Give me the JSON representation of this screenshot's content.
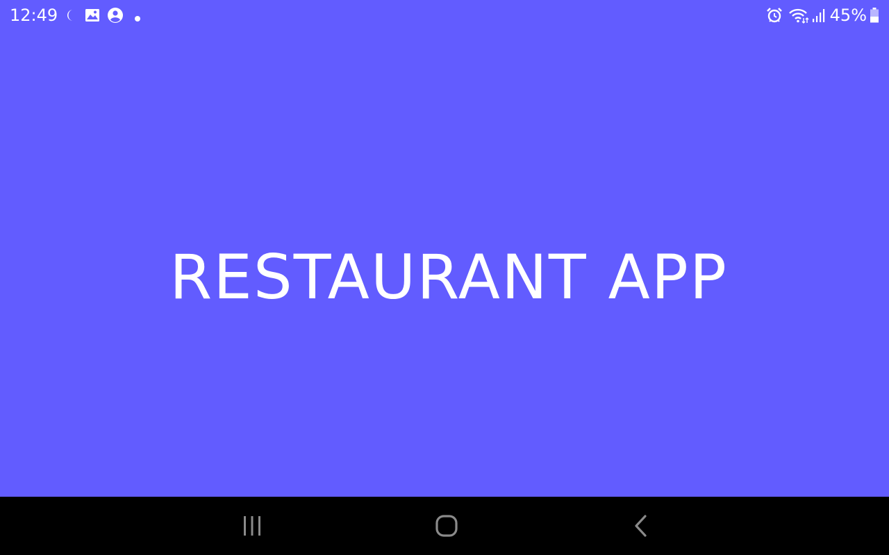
{
  "status_bar": {
    "time": "12:49",
    "left_icons": [
      "moon-icon",
      "gallery-icon",
      "account-icon",
      "dot-icon"
    ],
    "right_icons": [
      "alarm-icon",
      "wifi-icon",
      "signal-icon"
    ],
    "battery_percent": "45%",
    "battery_level": 0.45
  },
  "main": {
    "title": "RESTAURANT APP",
    "background_color": "#625cff",
    "text_color": "#ffffff"
  },
  "nav_bar": {
    "buttons": [
      "recent-apps-button",
      "home-button",
      "back-button"
    ],
    "background_color": "#000000",
    "icon_color": "#8a8a8a"
  }
}
